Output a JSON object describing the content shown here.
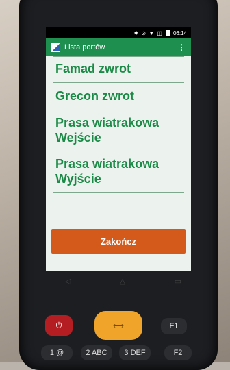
{
  "status_bar": {
    "time": "06:14"
  },
  "app_bar": {
    "title": "Lista portów",
    "overflow_icon": "vertical-dots-icon"
  },
  "list": {
    "items": [
      {
        "label": "Famad zwrot"
      },
      {
        "label": "Grecon zwrot"
      },
      {
        "label": "Prasa wiatrakowa\nWejście"
      },
      {
        "label": "Prasa  wiatrakowa\nWyjście"
      }
    ]
  },
  "finish_button": {
    "label": "Zakończ"
  },
  "keypad": {
    "f1": "F1",
    "k1": "1 @",
    "k2": "2 ABC",
    "k3": "3 DEF",
    "f2": "F2"
  },
  "colors": {
    "appbar": "#1f8f50",
    "list_text": "#1b8a46",
    "button": "#d45a1c"
  }
}
